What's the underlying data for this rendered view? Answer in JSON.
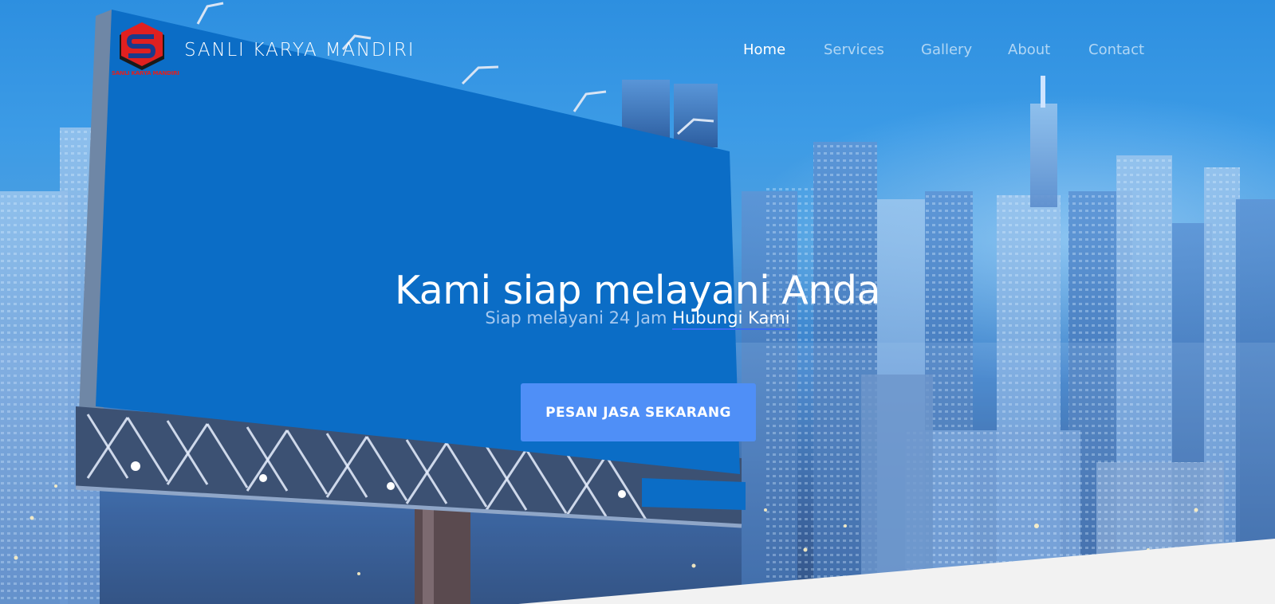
{
  "navbar": {
    "brand": "SANLI KARYA MANDIRI",
    "logo_caption": "SANLI KARYA MANDIRI",
    "links": [
      {
        "label": "Home",
        "active": true
      },
      {
        "label": "Services",
        "active": false
      },
      {
        "label": "Gallery",
        "active": false
      },
      {
        "label": "About",
        "active": false
      },
      {
        "label": "Contact",
        "active": false
      }
    ]
  },
  "hero": {
    "title": "Kami siap melayani Anda",
    "subtitle_prefix": "Siap melayani 24 Jam",
    "subtitle_link": "Hubungi Kami",
    "cta_label": "PESAN JASA SEKARANG"
  },
  "colors": {
    "accent": "#4f8ff7",
    "billboard": "#0b6dc6",
    "logo_red": "#e02020",
    "footer_bg": "#f2f2f2"
  },
  "icons": {
    "logo": "sanli-logo-icon"
  }
}
